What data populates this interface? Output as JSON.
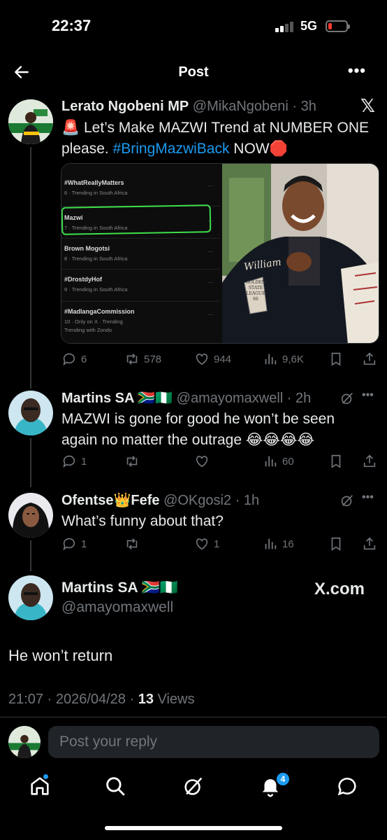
{
  "status_bar": {
    "time": "22:37",
    "network": "5G"
  },
  "header": {
    "title": "Post"
  },
  "main_post": {
    "name": "Lerato Ngobeni MP",
    "handle": "@MikaNgobeni",
    "time": "3h",
    "text_part1": "🚨 Let’s Make MAZWI Trend at NUMBER ONE please. ",
    "hashtag": "#BringMazwiBack",
    "text_part2": " NOW🛑",
    "replies": "6",
    "reposts": "578",
    "likes": "944",
    "views": "9,6K"
  },
  "trends": [
    {
      "title": "#WhatReallyMatters",
      "sub": "6 · Trending in South Africa"
    },
    {
      "title": "Mazwi",
      "sub": "7 · Trending in South Africa"
    },
    {
      "title": "Brown Mogotsi",
      "sub": "8 · Trending in South Africa"
    },
    {
      "title": "#DrostdyHof",
      "sub": "9 · Trending in South Africa"
    },
    {
      "title": "#MadlangaCommission",
      "sub": "10 · Only on X · Trending",
      "with": "Trending with Zondo"
    }
  ],
  "jacket_text": {
    "brand": "William",
    "patch": "GOLDEN STATE LEAGUE 66"
  },
  "reply1": {
    "name": "Martins SA 🇿🇦🇳🇬",
    "handle": "@amayomaxwell",
    "time": "2h",
    "text": "MAZWI is gone for good he won’t be seen again no matter the outrage 😂😂😂😂",
    "replies": "1",
    "views": "60"
  },
  "reply2": {
    "name": "Ofentse👑Fefe",
    "handle": "@OKgosi2",
    "time": "1h",
    "text": "What’s funny about that?",
    "replies": "1",
    "likes": "1",
    "views": "16"
  },
  "focus_post": {
    "name": "Martins SA 🇿🇦🇳🇬",
    "handle": "@amayomaxwell",
    "watermark": "X.com",
    "text": "He won’t return",
    "timestamp": "21:07 · 2026/04/28 · ",
    "views_count": "13",
    "views_label": " Views"
  },
  "reply_input": {
    "placeholder": "Post your reply"
  },
  "nav": {
    "notifications_badge": "4"
  },
  "colors": {
    "accent": "#1d9bf0",
    "muted": "#71767b",
    "background": "#000000"
  }
}
